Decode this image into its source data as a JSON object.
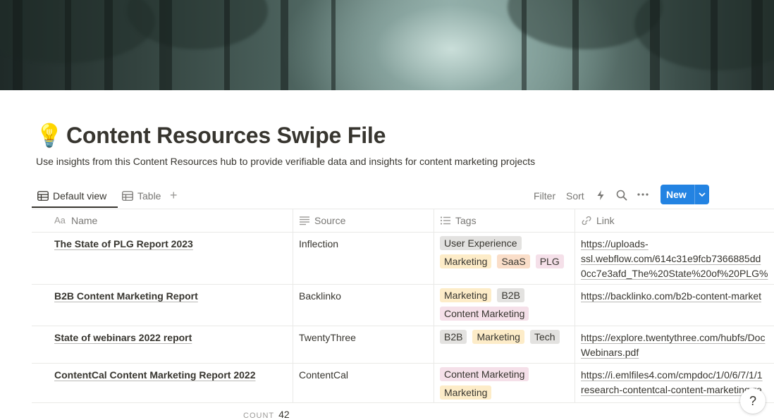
{
  "page": {
    "title_icon": "💡",
    "title": "Content Resources Swipe File",
    "description": "Use insights from this Content Resources hub to provide verifiable data and insights for content marketing projects"
  },
  "views": [
    {
      "label": "Default view",
      "icon": "table-icon",
      "active": true
    },
    {
      "label": "Table",
      "icon": "table-icon",
      "active": false
    }
  ],
  "toolbar": {
    "filter_label": "Filter",
    "sort_label": "Sort",
    "new_label": "New"
  },
  "columns": [
    {
      "label": "Name",
      "icon": "title-aa-icon"
    },
    {
      "label": "Source",
      "icon": "text-lines-icon"
    },
    {
      "label": "Tags",
      "icon": "list-icon"
    },
    {
      "label": "Link",
      "icon": "link-icon"
    }
  ],
  "tag_colors": {
    "User Experience": "#e3e2e0",
    "Marketing": "#fdecc8",
    "SaaS": "#fadec9",
    "PLG": "#f5e0e9",
    "B2B": "#e3e2e0",
    "Content Marketing": "#f5e0e9",
    "Tech": "#e3e2e0"
  },
  "rows": [
    {
      "name": "The State of PLG Report 2023",
      "source": "Inflection",
      "tags": [
        "User Experience",
        "Marketing",
        "SaaS",
        "PLG"
      ],
      "link_lines": [
        "https://uploads-",
        "ssl.webflow.com/614c31e9fcb7366885dd",
        "0cc7e3afd_The%20State%20of%20PLG%"
      ]
    },
    {
      "name": "B2B Content Marketing Report",
      "source": "Backlinko",
      "tags": [
        "Marketing",
        "B2B",
        "Content Marketing"
      ],
      "link_lines": [
        "https://backlinko.com/b2b-content-market"
      ]
    },
    {
      "name": "State of webinars 2022 report",
      "source": "TwentyThree",
      "tags": [
        "B2B",
        "Marketing",
        "Tech"
      ],
      "link_lines": [
        "https://explore.twentythree.com/hubfs/Doc",
        "Webinars.pdf"
      ]
    },
    {
      "name": "ContentCal Content Marketing Report 2022",
      "source": "ContentCal",
      "tags": [
        "Content Marketing",
        "Marketing"
      ],
      "link_lines": [
        "https://i.emlfiles4.com/cmpdoc/1/0/6/7/1/1",
        "research-contentcal-content-marketing-re"
      ]
    }
  ],
  "footer": {
    "count_label": "COUNT",
    "count_value": "42"
  },
  "help": {
    "label": "?"
  }
}
